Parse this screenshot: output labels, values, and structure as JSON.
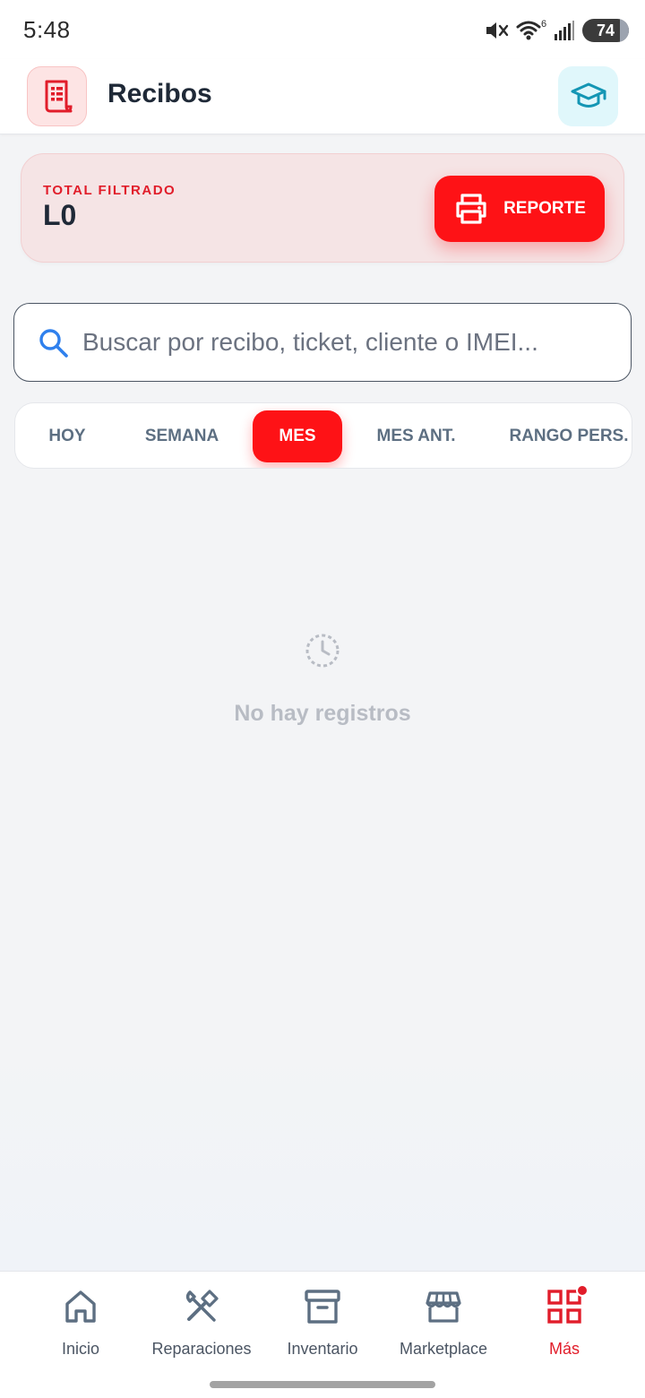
{
  "status_bar": {
    "time": "5:48",
    "wifi_label": "6",
    "battery": "74"
  },
  "header": {
    "title": "Recibos",
    "app_icon": "receipt-icon",
    "learn_icon": "graduation-cap-icon"
  },
  "total_card": {
    "label": "TOTAL FILTRADO",
    "value": "L0",
    "report_label": "REPORTE",
    "report_icon": "printer-icon"
  },
  "search": {
    "placeholder": "Buscar por recibo, ticket, cliente o IMEI...",
    "value": ""
  },
  "filters": {
    "tabs": [
      "HOY",
      "SEMANA",
      "MES",
      "MES ANT.",
      "RANGO PERS."
    ],
    "active": "MES"
  },
  "empty_state": {
    "icon": "clock-dashed-icon",
    "message": "No hay registros"
  },
  "bottom_nav": {
    "items": [
      {
        "label": "Inicio",
        "icon": "home-icon"
      },
      {
        "label": "Reparaciones",
        "icon": "tools-icon"
      },
      {
        "label": "Inventario",
        "icon": "archive-box-icon"
      },
      {
        "label": "Marketplace",
        "icon": "store-icon"
      },
      {
        "label": "Más",
        "icon": "grid-icon"
      }
    ],
    "active": "Más"
  },
  "colors": {
    "accent": "#fe1216",
    "accent_text": "#e11d2a",
    "teal": "#1496b4",
    "nav_icon": "#5d6f82"
  }
}
